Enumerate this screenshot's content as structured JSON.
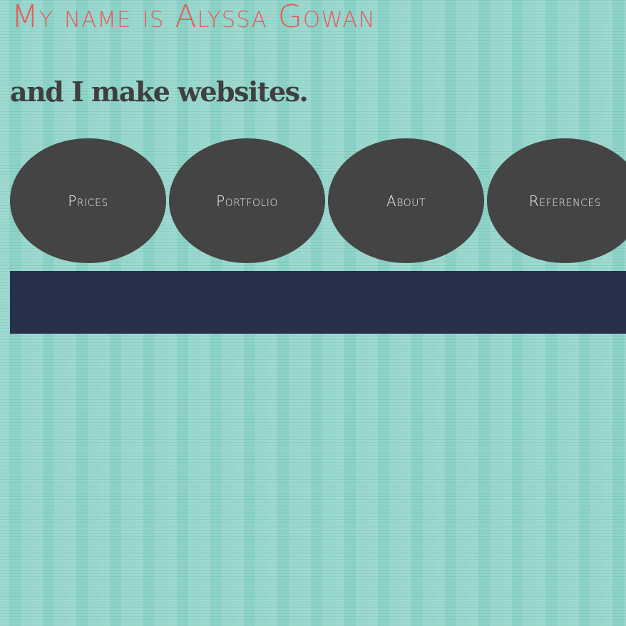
{
  "header": {
    "title": "My name is Alyssa Gowan",
    "tagline": "and I make websites."
  },
  "nav": {
    "items": [
      {
        "label": "Prices"
      },
      {
        "label": "Portfolio"
      },
      {
        "label": "About"
      },
      {
        "label": "References"
      }
    ]
  },
  "colors": {
    "background": "#8fd3c8",
    "title": "#e85a5a",
    "tagline": "#3f3f3f",
    "nav_bubble": "#444444",
    "nav_text": "#f2efe6",
    "banner": "#28304a"
  }
}
